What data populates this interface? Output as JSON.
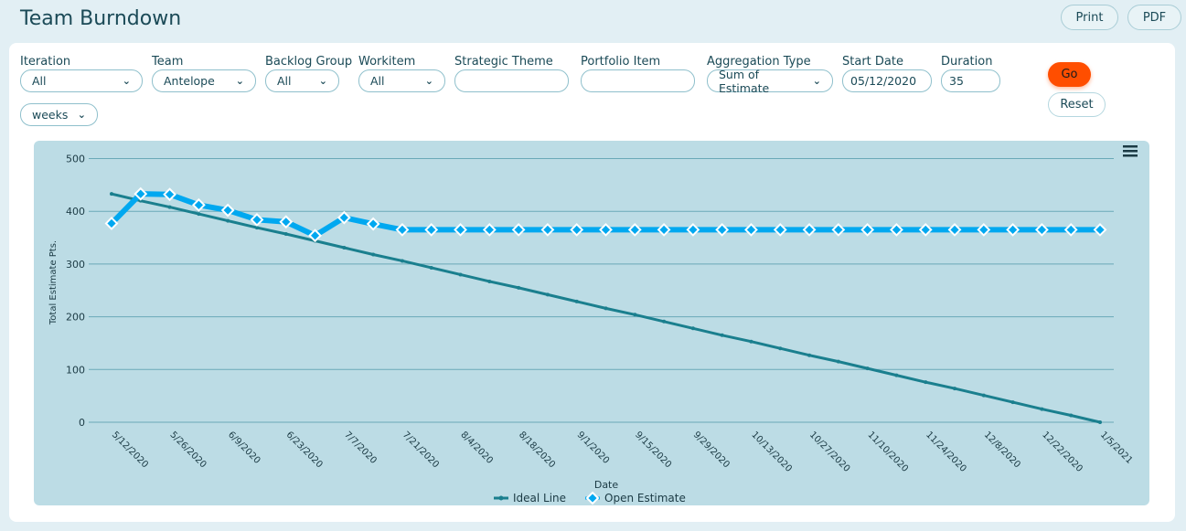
{
  "title": "Team Burndown",
  "toolbar": {
    "print": "Print",
    "pdf": "PDF"
  },
  "filters": {
    "iteration": {
      "label": "Iteration",
      "value": "All"
    },
    "team": {
      "label": "Team",
      "value": "Antelope"
    },
    "backlog_group": {
      "label": "Backlog Group",
      "value": "All"
    },
    "workitem": {
      "label": "Workitem",
      "value": "All"
    },
    "strategic_theme": {
      "label": "Strategic Theme",
      "value": ""
    },
    "portfolio_item": {
      "label": "Portfolio Item",
      "value": ""
    },
    "aggregation_type": {
      "label": "Aggregation Type",
      "value": "Sum of Estimate"
    },
    "start_date": {
      "label": "Start Date",
      "value": "05/12/2020"
    },
    "duration": {
      "label": "Duration",
      "value": "35"
    },
    "unit": {
      "value": "weeks"
    },
    "go": "Go",
    "reset": "Reset"
  },
  "chart_data": {
    "type": "line",
    "xlabel": "Date",
    "ylabel": "Total Estimate Pts.",
    "ylim": [
      0,
      500
    ],
    "yticks": [
      0,
      100,
      200,
      300,
      400,
      500
    ],
    "xtick_labels": [
      "5/12/2020",
      "5/26/2020",
      "6/9/2020",
      "6/23/2020",
      "7/7/2020",
      "7/21/2020",
      "8/4/2020",
      "8/18/2020",
      "9/1/2020",
      "9/15/2020",
      "9/29/2020",
      "10/13/2020",
      "10/27/2020",
      "11/10/2020",
      "11/24/2020",
      "12/8/2020",
      "12/22/2020",
      "1/5/2021"
    ],
    "point_count": 35,
    "legend": "bottom",
    "grid": true,
    "series": [
      {
        "name": "Ideal Line",
        "color": "#1a7f8e",
        "values": [
          433,
          420,
          408,
          395,
          382,
          369,
          357,
          344,
          331,
          318,
          306,
          293,
          280,
          267,
          255,
          242,
          229,
          216,
          204,
          191,
          178,
          165,
          153,
          140,
          127,
          115,
          102,
          89,
          76,
          64,
          51,
          38,
          25,
          13,
          0
        ]
      },
      {
        "name": "Open Estimate",
        "color": "#00a8f0",
        "values": [
          377,
          433,
          432,
          412,
          402,
          384,
          380,
          354,
          388,
          376,
          365,
          365,
          365,
          365,
          365,
          365,
          365,
          365,
          365,
          365,
          365,
          365,
          365,
          365,
          365,
          365,
          365,
          365,
          365,
          365,
          365,
          365,
          365,
          365,
          365
        ]
      }
    ]
  }
}
